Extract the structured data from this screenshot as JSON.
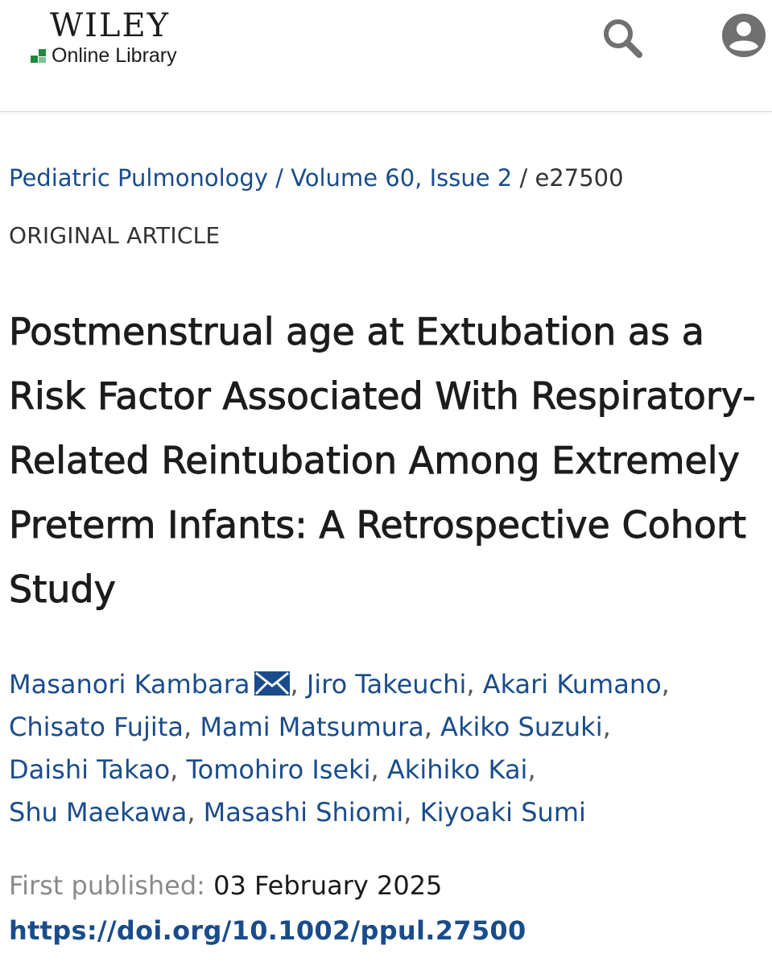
{
  "header": {
    "logo_main": "WILEY",
    "logo_sub": "Online Library",
    "brand_color": "#1f8a3e",
    "search_icon": "search-icon",
    "account_icon": "account-icon"
  },
  "breadcrumb": {
    "journal": "Pediatric Pulmonology",
    "sep1": " / ",
    "volume": "Volume 60, Issue 2",
    "sep2": " /  ",
    "article_id": "e27500"
  },
  "article": {
    "type": "ORIGINAL ARTICLE",
    "title": "Postmenstrual age at Extubation as a Risk Factor Associated With Respiratory-Related Reintubation Among Extremely Preterm Infants: A Retrospective Cohort Study",
    "authors": [
      "Masanori Kambara",
      "Jiro Takeuchi",
      "Akari Kumano",
      "Chisato Fujita",
      "Mami Matsumura",
      "Akiko Suzuki",
      "Daishi Takao",
      "Tomohiro Iseki",
      "Akihiko Kai",
      "Shu Maekawa",
      "Masashi Shiomi",
      "Kiyoaki Sumi"
    ],
    "comma": ", ",
    "corresponding_icon": "mail-icon",
    "first_published_label": "First published:",
    "first_published_value": "03 February 2025",
    "doi": "https://doi.org/10.1002/ppul.27500"
  },
  "colors": {
    "link": "#1a4c8b",
    "text": "#1c1c1c",
    "muted": "#8a8a8a",
    "icon": "#707070"
  }
}
